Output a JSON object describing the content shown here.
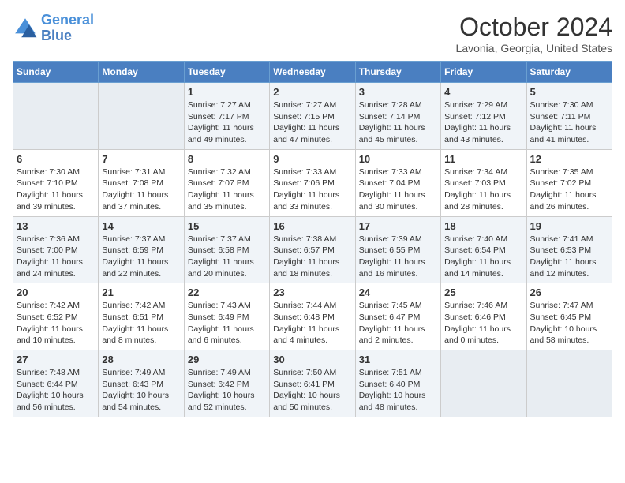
{
  "header": {
    "logo_line1": "General",
    "logo_line2": "Blue",
    "month": "October 2024",
    "location": "Lavonia, Georgia, United States"
  },
  "days_of_week": [
    "Sunday",
    "Monday",
    "Tuesday",
    "Wednesday",
    "Thursday",
    "Friday",
    "Saturday"
  ],
  "weeks": [
    [
      {
        "num": "",
        "sunrise": "",
        "sunset": "",
        "daylight": "",
        "empty": true
      },
      {
        "num": "",
        "sunrise": "",
        "sunset": "",
        "daylight": "",
        "empty": true
      },
      {
        "num": "1",
        "sunrise": "Sunrise: 7:27 AM",
        "sunset": "Sunset: 7:17 PM",
        "daylight": "Daylight: 11 hours and 49 minutes."
      },
      {
        "num": "2",
        "sunrise": "Sunrise: 7:27 AM",
        "sunset": "Sunset: 7:15 PM",
        "daylight": "Daylight: 11 hours and 47 minutes."
      },
      {
        "num": "3",
        "sunrise": "Sunrise: 7:28 AM",
        "sunset": "Sunset: 7:14 PM",
        "daylight": "Daylight: 11 hours and 45 minutes."
      },
      {
        "num": "4",
        "sunrise": "Sunrise: 7:29 AM",
        "sunset": "Sunset: 7:12 PM",
        "daylight": "Daylight: 11 hours and 43 minutes."
      },
      {
        "num": "5",
        "sunrise": "Sunrise: 7:30 AM",
        "sunset": "Sunset: 7:11 PM",
        "daylight": "Daylight: 11 hours and 41 minutes."
      }
    ],
    [
      {
        "num": "6",
        "sunrise": "Sunrise: 7:30 AM",
        "sunset": "Sunset: 7:10 PM",
        "daylight": "Daylight: 11 hours and 39 minutes."
      },
      {
        "num": "7",
        "sunrise": "Sunrise: 7:31 AM",
        "sunset": "Sunset: 7:08 PM",
        "daylight": "Daylight: 11 hours and 37 minutes."
      },
      {
        "num": "8",
        "sunrise": "Sunrise: 7:32 AM",
        "sunset": "Sunset: 7:07 PM",
        "daylight": "Daylight: 11 hours and 35 minutes."
      },
      {
        "num": "9",
        "sunrise": "Sunrise: 7:33 AM",
        "sunset": "Sunset: 7:06 PM",
        "daylight": "Daylight: 11 hours and 33 minutes."
      },
      {
        "num": "10",
        "sunrise": "Sunrise: 7:33 AM",
        "sunset": "Sunset: 7:04 PM",
        "daylight": "Daylight: 11 hours and 30 minutes."
      },
      {
        "num": "11",
        "sunrise": "Sunrise: 7:34 AM",
        "sunset": "Sunset: 7:03 PM",
        "daylight": "Daylight: 11 hours and 28 minutes."
      },
      {
        "num": "12",
        "sunrise": "Sunrise: 7:35 AM",
        "sunset": "Sunset: 7:02 PM",
        "daylight": "Daylight: 11 hours and 26 minutes."
      }
    ],
    [
      {
        "num": "13",
        "sunrise": "Sunrise: 7:36 AM",
        "sunset": "Sunset: 7:00 PM",
        "daylight": "Daylight: 11 hours and 24 minutes."
      },
      {
        "num": "14",
        "sunrise": "Sunrise: 7:37 AM",
        "sunset": "Sunset: 6:59 PM",
        "daylight": "Daylight: 11 hours and 22 minutes."
      },
      {
        "num": "15",
        "sunrise": "Sunrise: 7:37 AM",
        "sunset": "Sunset: 6:58 PM",
        "daylight": "Daylight: 11 hours and 20 minutes."
      },
      {
        "num": "16",
        "sunrise": "Sunrise: 7:38 AM",
        "sunset": "Sunset: 6:57 PM",
        "daylight": "Daylight: 11 hours and 18 minutes."
      },
      {
        "num": "17",
        "sunrise": "Sunrise: 7:39 AM",
        "sunset": "Sunset: 6:55 PM",
        "daylight": "Daylight: 11 hours and 16 minutes."
      },
      {
        "num": "18",
        "sunrise": "Sunrise: 7:40 AM",
        "sunset": "Sunset: 6:54 PM",
        "daylight": "Daylight: 11 hours and 14 minutes."
      },
      {
        "num": "19",
        "sunrise": "Sunrise: 7:41 AM",
        "sunset": "Sunset: 6:53 PM",
        "daylight": "Daylight: 11 hours and 12 minutes."
      }
    ],
    [
      {
        "num": "20",
        "sunrise": "Sunrise: 7:42 AM",
        "sunset": "Sunset: 6:52 PM",
        "daylight": "Daylight: 11 hours and 10 minutes."
      },
      {
        "num": "21",
        "sunrise": "Sunrise: 7:42 AM",
        "sunset": "Sunset: 6:51 PM",
        "daylight": "Daylight: 11 hours and 8 minutes."
      },
      {
        "num": "22",
        "sunrise": "Sunrise: 7:43 AM",
        "sunset": "Sunset: 6:49 PM",
        "daylight": "Daylight: 11 hours and 6 minutes."
      },
      {
        "num": "23",
        "sunrise": "Sunrise: 7:44 AM",
        "sunset": "Sunset: 6:48 PM",
        "daylight": "Daylight: 11 hours and 4 minutes."
      },
      {
        "num": "24",
        "sunrise": "Sunrise: 7:45 AM",
        "sunset": "Sunset: 6:47 PM",
        "daylight": "Daylight: 11 hours and 2 minutes."
      },
      {
        "num": "25",
        "sunrise": "Sunrise: 7:46 AM",
        "sunset": "Sunset: 6:46 PM",
        "daylight": "Daylight: 11 hours and 0 minutes."
      },
      {
        "num": "26",
        "sunrise": "Sunrise: 7:47 AM",
        "sunset": "Sunset: 6:45 PM",
        "daylight": "Daylight: 10 hours and 58 minutes."
      }
    ],
    [
      {
        "num": "27",
        "sunrise": "Sunrise: 7:48 AM",
        "sunset": "Sunset: 6:44 PM",
        "daylight": "Daylight: 10 hours and 56 minutes."
      },
      {
        "num": "28",
        "sunrise": "Sunrise: 7:49 AM",
        "sunset": "Sunset: 6:43 PM",
        "daylight": "Daylight: 10 hours and 54 minutes."
      },
      {
        "num": "29",
        "sunrise": "Sunrise: 7:49 AM",
        "sunset": "Sunset: 6:42 PM",
        "daylight": "Daylight: 10 hours and 52 minutes."
      },
      {
        "num": "30",
        "sunrise": "Sunrise: 7:50 AM",
        "sunset": "Sunset: 6:41 PM",
        "daylight": "Daylight: 10 hours and 50 minutes."
      },
      {
        "num": "31",
        "sunrise": "Sunrise: 7:51 AM",
        "sunset": "Sunset: 6:40 PM",
        "daylight": "Daylight: 10 hours and 48 minutes."
      },
      {
        "num": "",
        "sunrise": "",
        "sunset": "",
        "daylight": "",
        "empty": true
      },
      {
        "num": "",
        "sunrise": "",
        "sunset": "",
        "daylight": "",
        "empty": true
      }
    ]
  ]
}
